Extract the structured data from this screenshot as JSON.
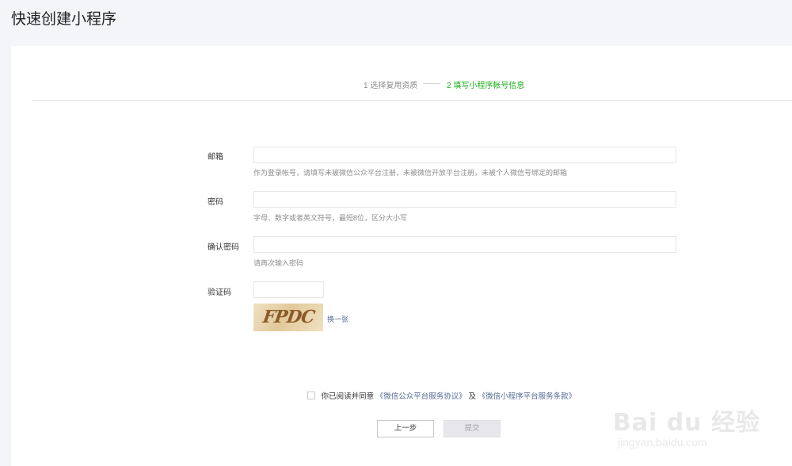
{
  "page": {
    "title": "快速创建小程序"
  },
  "steps": {
    "step1": "1 选择复用资质",
    "step2": "2 填写小程序帐号信息"
  },
  "form": {
    "email": {
      "label": "邮箱",
      "value": "",
      "hint": "作为登录帐号，请填写未被微信公众平台注册，未被微信开放平台注册，未被个人微信号绑定的邮箱"
    },
    "password": {
      "label": "密码",
      "value": "",
      "hint": "字母、数字或者英文符号，最短8位，区分大小写"
    },
    "confirm": {
      "label": "确认密码",
      "value": "",
      "hint": "请再次输入密码"
    },
    "captcha": {
      "label": "验证码",
      "value": "",
      "image_text": "FPDC",
      "refresh": "换一张"
    }
  },
  "agreement": {
    "text": "你已阅读并同意",
    "link1": "《微信公众平台服务协议》",
    "and": "及",
    "link2": "《微信小程序平台服务条款》"
  },
  "buttons": {
    "prev": "上一步",
    "submit": "提交"
  },
  "watermark": {
    "logo": "Bai du 经验",
    "url": "jingyan.baidu.com"
  },
  "colors": {
    "accent_green": "#1aad19",
    "link_blue": "#576b95"
  }
}
